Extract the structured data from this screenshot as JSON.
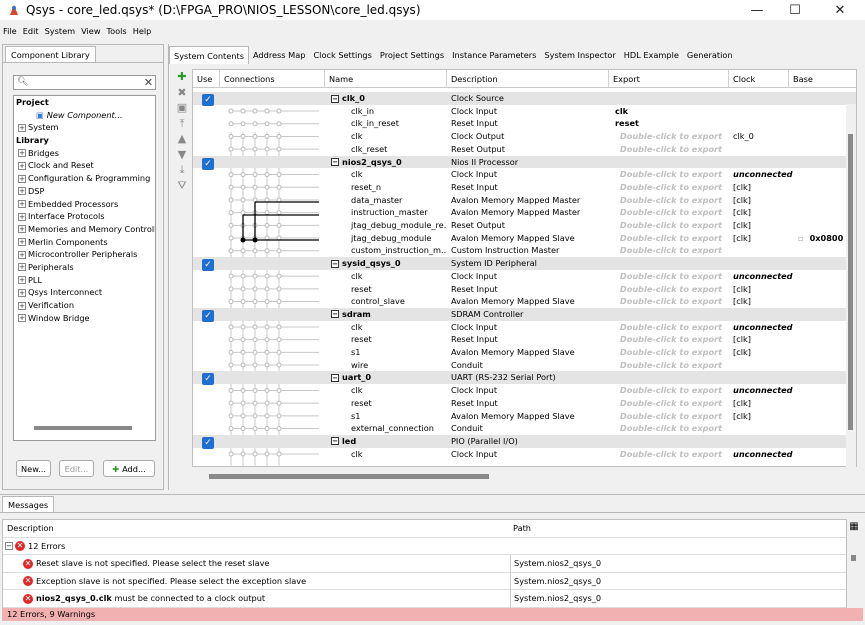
{
  "window": {
    "title": "Qsys - core_led.qsys* (D:\\FPGA_PRO\\NIOS_LESSON\\core_led.qsys)"
  },
  "menu": [
    "File",
    "Edit",
    "System",
    "View",
    "Tools",
    "Help"
  ],
  "library": {
    "tab": "Component Library",
    "project_label": "Project",
    "new_component": "New Component...",
    "system_label": "System",
    "library_label": "Library",
    "items": [
      "Bridges",
      "Clock and Reset",
      "Configuration & Programming",
      "DSP",
      "Embedded Processors",
      "Interface Protocols",
      "Memories and Memory Controllers",
      "Merlin Components",
      "Microcontroller Peripherals",
      "Peripherals",
      "PLL",
      "Qsys Interconnect",
      "Verification",
      "Window Bridge"
    ],
    "buttons": {
      "new": "New...",
      "edit": "Edit...",
      "add": "Add..."
    }
  },
  "tabs": [
    "System Contents",
    "Address Map",
    "Clock Settings",
    "Project Settings",
    "Instance Parameters",
    "System Inspector",
    "HDL Example",
    "Generation"
  ],
  "table": {
    "headers": {
      "use": "Use",
      "connections": "Connections",
      "name": "Name",
      "description": "Description",
      "export": "Export",
      "clock": "Clock",
      "base": "Base"
    },
    "rows": [
      {
        "name": "clk_0",
        "desc": "Clock Source",
        "export": "",
        "clock": "",
        "base": "",
        "group": true
      },
      {
        "name": "clk_in",
        "desc": "Clock Input",
        "export": "clk",
        "clock": "",
        "base": ""
      },
      {
        "name": "clk_in_reset",
        "desc": "Reset Input",
        "export": "reset",
        "clock": "",
        "base": ""
      },
      {
        "name": "clk",
        "desc": "Clock Output",
        "export": "Double-click to export",
        "clock": "clk_0",
        "base": ""
      },
      {
        "name": "clk_reset",
        "desc": "Reset Output",
        "export": "Double-click to export",
        "clock": "",
        "base": ""
      },
      {
        "name": "nios2_qsys_0",
        "desc": "Nios II Processor",
        "export": "",
        "clock": "",
        "base": "",
        "group": true
      },
      {
        "name": "clk",
        "desc": "Clock Input",
        "export": "Double-click to export",
        "clock": "unconnected",
        "base": ""
      },
      {
        "name": "reset_n",
        "desc": "Reset Input",
        "export": "Double-click to export",
        "clock": "[clk]",
        "base": ""
      },
      {
        "name": "data_master",
        "desc": "Avalon Memory Mapped Master",
        "export": "Double-click to export",
        "clock": "[clk]",
        "base": ""
      },
      {
        "name": "instruction_master",
        "desc": "Avalon Memory Mapped Master",
        "export": "Double-click to export",
        "clock": "[clk]",
        "base": ""
      },
      {
        "name": "jtag_debug_module_re...",
        "desc": "Reset Output",
        "export": "Double-click to export",
        "clock": "[clk]",
        "base": ""
      },
      {
        "name": "jtag_debug_module",
        "desc": "Avalon Memory Mapped Slave",
        "export": "Double-click to export",
        "clock": "[clk]",
        "base": "0x0800"
      },
      {
        "name": "custom_instruction_m...",
        "desc": "Custom Instruction Master",
        "export": "Double-click to export",
        "clock": "",
        "base": ""
      },
      {
        "name": "sysid_qsys_0",
        "desc": "System ID Peripheral",
        "export": "",
        "clock": "",
        "base": "",
        "group": true
      },
      {
        "name": "clk",
        "desc": "Clock Input",
        "export": "Double-click to export",
        "clock": "unconnected",
        "base": ""
      },
      {
        "name": "reset",
        "desc": "Reset Input",
        "export": "Double-click to export",
        "clock": "[clk]",
        "base": ""
      },
      {
        "name": "control_slave",
        "desc": "Avalon Memory Mapped Slave",
        "export": "Double-click to export",
        "clock": "[clk]",
        "base": ""
      },
      {
        "name": "sdram",
        "desc": "SDRAM Controller",
        "export": "",
        "clock": "",
        "base": "",
        "group": true
      },
      {
        "name": "clk",
        "desc": "Clock Input",
        "export": "Double-click to export",
        "clock": "unconnected",
        "base": ""
      },
      {
        "name": "reset",
        "desc": "Reset Input",
        "export": "Double-click to export",
        "clock": "[clk]",
        "base": ""
      },
      {
        "name": "s1",
        "desc": "Avalon Memory Mapped Slave",
        "export": "Double-click to export",
        "clock": "[clk]",
        "base": ""
      },
      {
        "name": "wire",
        "desc": "Conduit",
        "export": "Double-click to export",
        "clock": "",
        "base": ""
      },
      {
        "name": "uart_0",
        "desc": "UART (RS-232 Serial Port)",
        "export": "",
        "clock": "",
        "base": "",
        "group": true
      },
      {
        "name": "clk",
        "desc": "Clock Input",
        "export": "Double-click to export",
        "clock": "unconnected",
        "base": ""
      },
      {
        "name": "reset",
        "desc": "Reset Input",
        "export": "Double-click to export",
        "clock": "[clk]",
        "base": ""
      },
      {
        "name": "s1",
        "desc": "Avalon Memory Mapped Slave",
        "export": "Double-click to export",
        "clock": "[clk]",
        "base": ""
      },
      {
        "name": "external_connection",
        "desc": "Conduit",
        "export": "Double-click to export",
        "clock": "",
        "base": ""
      },
      {
        "name": "led",
        "desc": "PIO (Parallel I/O)",
        "export": "",
        "clock": "",
        "base": "",
        "group": true
      },
      {
        "name": "clk",
        "desc": "Clock Input",
        "export": "Double-click to export",
        "clock": "unconnected",
        "base": ""
      }
    ]
  },
  "messages": {
    "tab": "Messages",
    "headers": {
      "description": "Description",
      "path": "Path"
    },
    "group": "12 Errors",
    "rows": [
      {
        "text": "Reset slave is not specified. Please select the reset slave",
        "bold": "",
        "path": "System.nios2_qsys_0"
      },
      {
        "text": "Exception slave is not specified. Please select the exception slave",
        "bold": "",
        "path": "System.nios2_qsys_0"
      },
      {
        "text": " must be connected to a clock output",
        "bold": "nios2_qsys_0.clk",
        "path": "System.nios2_qsys_0"
      }
    ]
  },
  "status": "12 Errors, 9 Warnings"
}
